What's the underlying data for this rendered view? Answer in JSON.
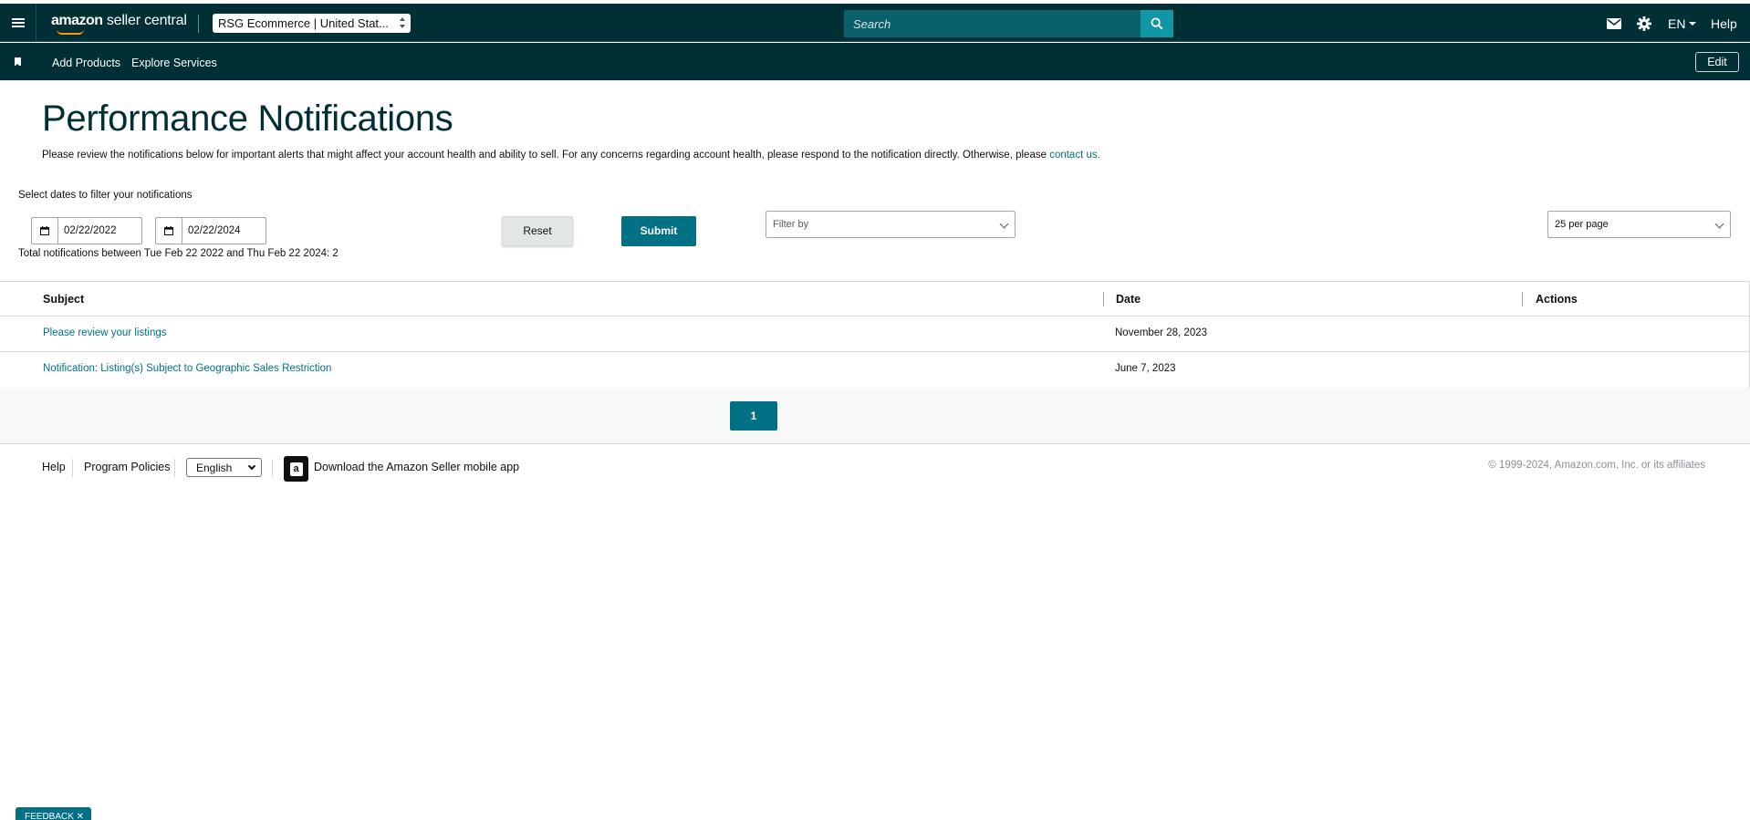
{
  "header": {
    "logo_brand": "amazon",
    "logo_product": " seller central",
    "account_selector": "RSG Ecommerce | United Stat...",
    "search_placeholder": "Search",
    "language": "EN",
    "help": "Help",
    "icons": [
      "menu-icon",
      "search-icon",
      "mail-icon",
      "gear-icon"
    ]
  },
  "nav": {
    "items": [
      {
        "label": "Add Products"
      },
      {
        "label": "Explore Services"
      }
    ],
    "edit": "Edit"
  },
  "main": {
    "title": "Performance Notifications",
    "intro_text": "Please review the notifications below for important alerts that might affect your account health and ability to sell. For any concerns regarding account health, please respond to the notification directly. Otherwise, please ",
    "intro_link": "contact us.",
    "filter_label": "Select dates to filter your notifications",
    "start_date": "02/22/2022",
    "end_date": "02/22/2024",
    "total_text": "Total notifications between Tue Feb 22 2022 and Thu Feb 22 2024: 2",
    "reset": "Reset",
    "submit": "Submit",
    "filter_by": "Filter by",
    "per_page": "25 per page"
  },
  "table": {
    "columns": [
      "Subject",
      "Date",
      "Actions"
    ],
    "rows": [
      {
        "subject": "Please review your listings",
        "date": "November 28, 2023",
        "actions": ""
      },
      {
        "subject": "Notification: Listing(s) Subject to Geographic Sales Restriction",
        "date": "June 7, 2023",
        "actions": ""
      }
    ]
  },
  "pagination": {
    "current_page": "1"
  },
  "footer": {
    "help": "Help",
    "program_policies": "Program Policies",
    "language": "English",
    "app_text": "Download the Amazon Seller mobile app",
    "copyright": "© 1999-2024, Amazon.com, Inc. or its affiliates"
  },
  "feedback": "FEEDBACK ✕",
  "colors": {
    "header_bg": "#002f36",
    "accent": "#007185",
    "search_btn": "#1196a5"
  }
}
